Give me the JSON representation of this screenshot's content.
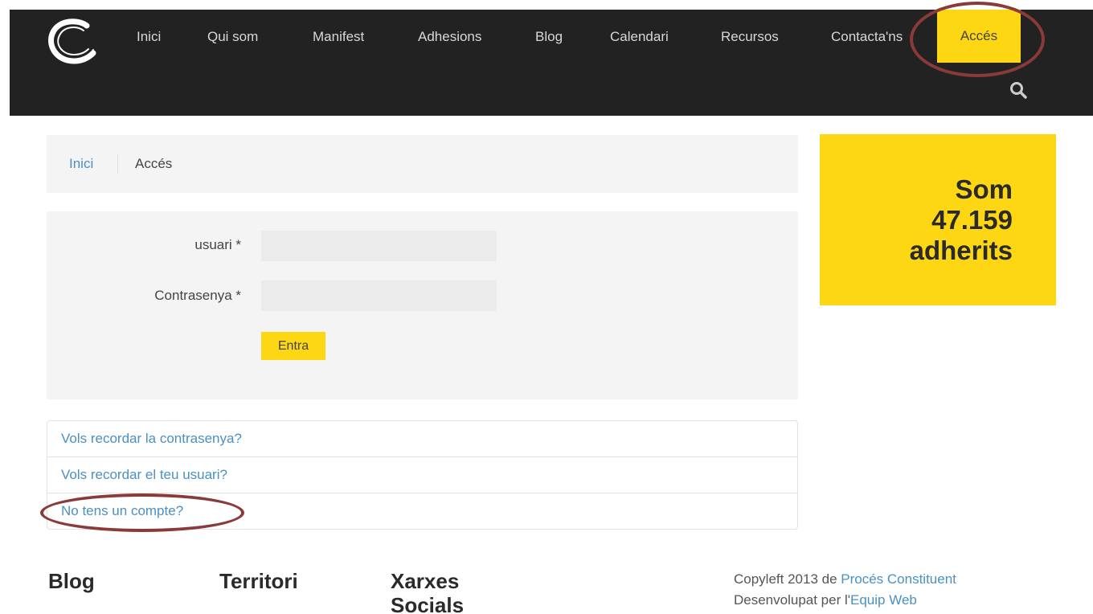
{
  "nav": {
    "items": [
      "Inici",
      "Qui som",
      "Manifest",
      "Adhesions",
      "Blog",
      "Calendari",
      "Recursos",
      "Contacta'ns"
    ],
    "active": "Accés"
  },
  "breadcrumb": {
    "home": "Inici",
    "current": "Accés"
  },
  "login": {
    "username_label": "usuari *",
    "password_label": "Contrasenya *",
    "username_value": "",
    "password_value": "",
    "submit_label": "Entra"
  },
  "links": {
    "remember_password": "Vols recordar la contrasenya?",
    "remember_user": "Vols recordar el teu usuari?",
    "no_account": "No tens un compte?"
  },
  "members": {
    "line1": "Som",
    "line2": "47.159",
    "line3": "adherits"
  },
  "footer": {
    "blog": "Blog",
    "territori": "Territori",
    "xarxes_line1": "Xarxes",
    "xarxes_line2": "Socials",
    "copyleft_prefix": "Copyleft 2013 de ",
    "copyleft_link": "Procés Constituent",
    "dev_prefix": "Desenvolupat per l'",
    "dev_link": "Equip Web"
  },
  "colors": {
    "accent_yellow": "#fdd714",
    "navbar_bg": "#222222",
    "link_blue": "#4a90c2",
    "highlight_ring": "#8b3a3a"
  }
}
